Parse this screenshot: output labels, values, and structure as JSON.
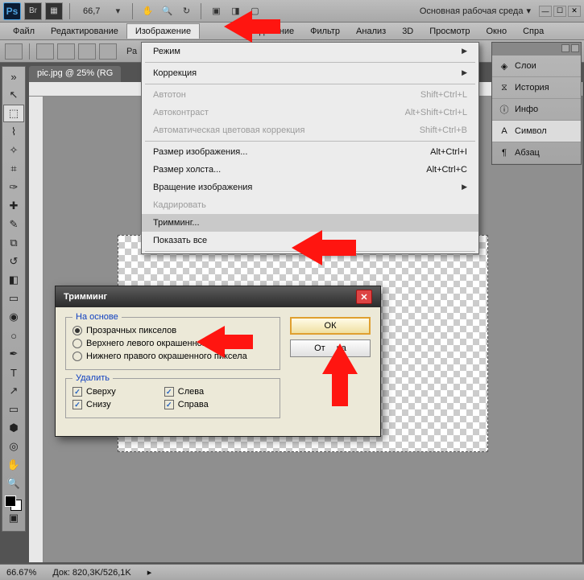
{
  "titlebar": {
    "zoom": "66,7",
    "workspace": "Основная рабочая среда"
  },
  "menubar": {
    "file": "Файл",
    "edit": "Редактирование",
    "image": "Изображение",
    "select": "ыделение",
    "filter": "Фильтр",
    "analysis": "Анализ",
    "threeD": "3D",
    "view": "Просмотр",
    "window": "Окно",
    "help": "Спра"
  },
  "optionsbar": {
    "opt1": "Ра"
  },
  "doctab": "pic.jpg @ 25% (RG",
  "dropdown": {
    "mode": "Режим",
    "adjustments": "Коррекция",
    "autotone": "Автотон",
    "autotone_sc": "Shift+Ctrl+L",
    "autocontrast": "Автоконтраст",
    "autocontrast_sc": "Alt+Shift+Ctrl+L",
    "autocolor": "Автоматическая цветовая коррекция",
    "autocolor_sc": "Shift+Ctrl+B",
    "imagesize": "Размер изображения...",
    "imagesize_sc": "Alt+Ctrl+I",
    "canvassize": "Размер холста...",
    "canvassize_sc": "Alt+Ctrl+C",
    "rotation": "Вращение изображения",
    "crop": "Кадрировать",
    "trim": "Тримминг...",
    "revealall": "Показать все"
  },
  "rightpanel": {
    "layers": "Слои",
    "history": "История",
    "info": "Инфо",
    "character": "Символ",
    "paragraph": "Абзац"
  },
  "dialog": {
    "title": "Тримминг",
    "basedon_legend": "На основе",
    "opt_transparent": "Прозрачных пикселов",
    "opt_topleft": "Верхнего левого окрашенного",
    "opt_topleft2": "ла",
    "opt_bottomright": "Нижнего правого окрашенного пиксела",
    "trimaway_legend": "Удалить",
    "top": "Сверху",
    "bottom": "Снизу",
    "left": "Слева",
    "right": "Справа",
    "ok": "ОК",
    "cancel_pre": "От",
    "cancel_post": "на"
  },
  "status": {
    "zoom": "66.67%",
    "docinfo": "Док: 820,3K/526,1K"
  }
}
